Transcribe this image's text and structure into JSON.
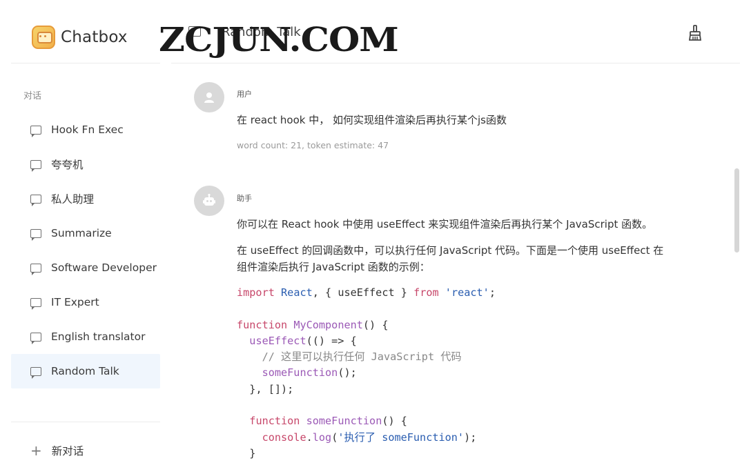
{
  "app": {
    "name": "Chatbox"
  },
  "watermark": "ZCJUN.COM",
  "header": {
    "title": "Random Talk"
  },
  "sidebar": {
    "section_label": "对话",
    "conversations": [
      {
        "label": "Hook Fn Exec",
        "active": false
      },
      {
        "label": "夸夸机",
        "active": false
      },
      {
        "label": "私人助理",
        "active": false
      },
      {
        "label": "Summarize",
        "active": false
      },
      {
        "label": "Software Developer",
        "active": false
      },
      {
        "label": "IT Expert",
        "active": false
      },
      {
        "label": "English translator",
        "active": false
      },
      {
        "label": "Random Talk",
        "active": true
      }
    ],
    "new_chat": "新对话"
  },
  "messages": {
    "user": {
      "role": "用户",
      "text": "在 react hook 中， 如何实现组件渲染后再执行某个js函数",
      "meta": "word count: 21, token estimate: 47"
    },
    "assistant": {
      "role": "助手",
      "para1": "你可以在 React hook 中使用 useEffect 来实现组件渲染后再执行某个 JavaScript 函数。",
      "para2_line1": "在 useEffect 的回调函数中，可以执行任何 JavaScript 代码。下面是一个使用 useEffect 在",
      "para2_line2": "组件渲染后执行 JavaScript 函数的示例：",
      "code": {
        "l1_import": "import",
        "l1_react": "React",
        "l1_mid": ", { useEffect } ",
        "l1_from": "from",
        "l1_str": "'react'",
        "l1_end": ";",
        "l3_function": "function",
        "l3_name": "MyComponent",
        "l3_end": "() {",
        "l4_call": "useEffect",
        "l4_end": "(() => {",
        "l5_comment": "// 这里可以执行任何 JavaScript 代码",
        "l6_call": "someFunction",
        "l6_end": "();",
        "l7": "}, []);",
        "l9_function": "function",
        "l9_name": "someFunction",
        "l9_end": "() {",
        "l10_obj": "console",
        "l10_dot": ".",
        "l10_method": "log",
        "l10_open": "(",
        "l10_str": "'执行了 someFunction'",
        "l10_end": ");",
        "l11": "}"
      }
    }
  },
  "colors": {
    "active_bg": "#f0f6fd",
    "keyword": "#c7476a",
    "function": "#9b59b6",
    "string": "#2a5db0"
  }
}
